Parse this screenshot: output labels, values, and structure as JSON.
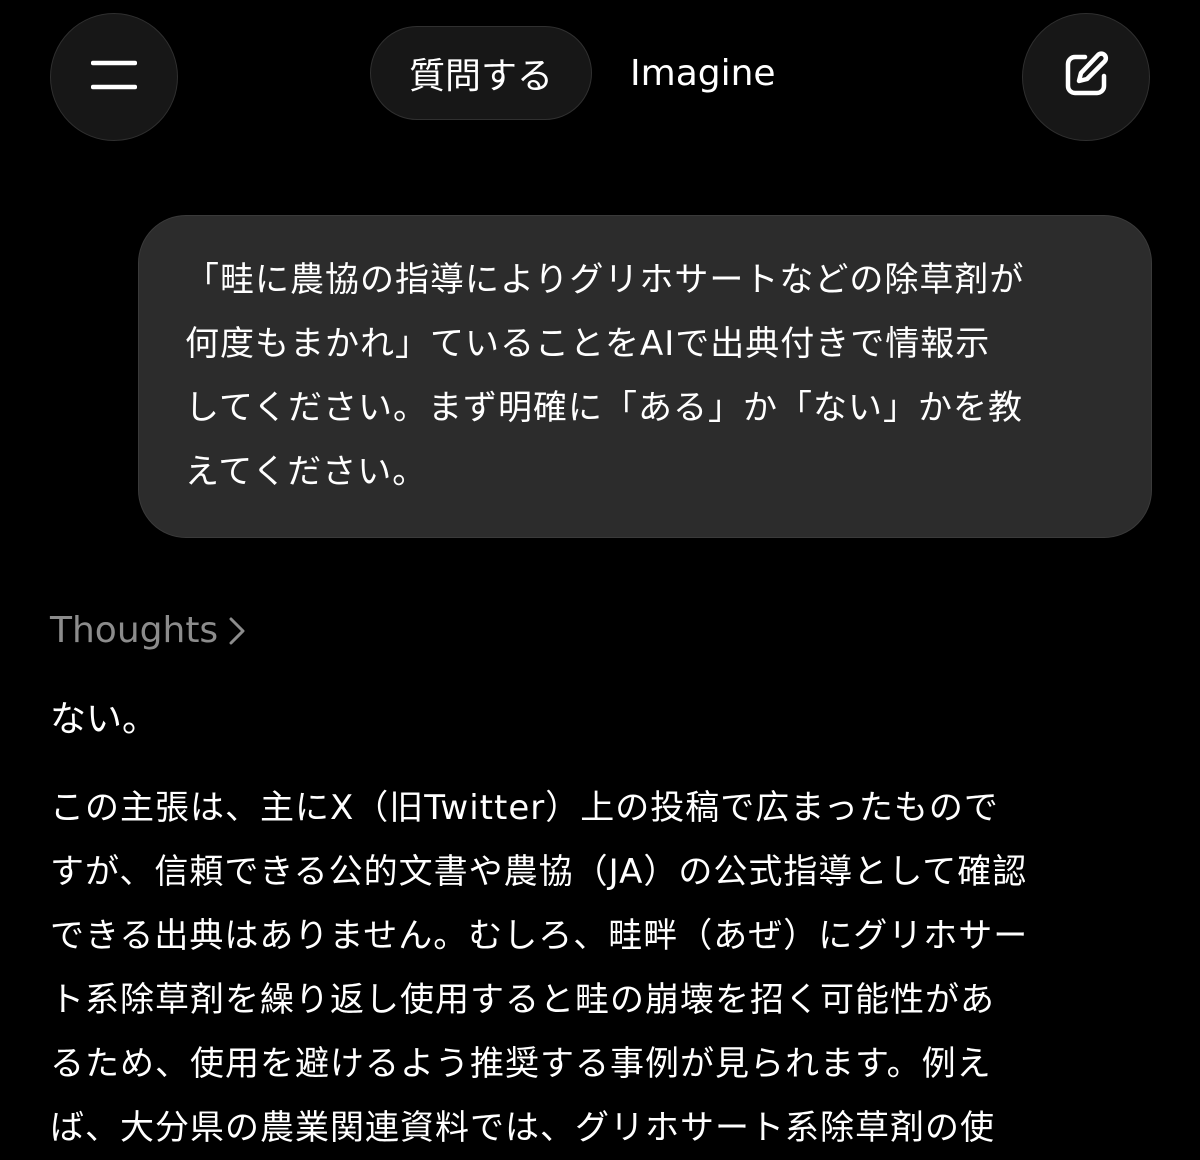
{
  "header": {
    "menu_icon": "menu-icon",
    "compose_icon": "compose-icon",
    "tabs": [
      {
        "label": "質問する",
        "active": true
      },
      {
        "label": "Imagine",
        "active": false
      }
    ]
  },
  "conversation": {
    "user_message": "「畦に農協の指導によりグリホサートなどの除草剤が\n何度もまかれ」ていることをAIで出典付きで情報示\nしてください。まず明確に「ある」か「ない」かを教\nえてください。",
    "thoughts_label": "Thoughts",
    "answer_short": "ない。",
    "answer_body": "この主張は、主にX（旧Twitter）上の投稿で広まったもので\nすが、信頼できる公的文書や農協（JA）の公式指導として確認\nできる出典はありません。むしろ、畦畔（あぜ）にグリホサー\nト系除草剤を繰り返し使用すると畦の崩壊を招く可能性があ\nるため、使用を避けるよう推奨する事例が見られます。例え\nば、大分県の農業関連資料では、グリホサート系除草剤の使"
  },
  "colors": {
    "background": "#000000",
    "bubble": "#2c2c2c",
    "button": "#171717",
    "muted_text": "#8c8c8c"
  }
}
